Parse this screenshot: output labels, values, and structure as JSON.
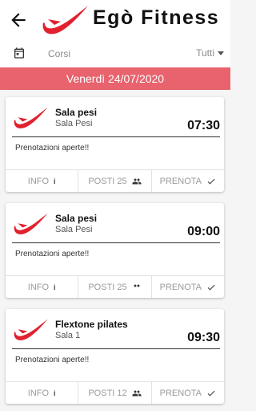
{
  "header": {
    "title": "Egò Fitness",
    "back_icon": "arrow-left-icon",
    "logo_icon": "brand-swoosh-icon"
  },
  "filter": {
    "calendar_icon": "calendar-icon",
    "category_placeholder": "Corsi",
    "selected": "Tutti"
  },
  "date_bar": {
    "label": "Venerdì 24/07/2020"
  },
  "colors": {
    "brand_red": "#e2202e",
    "date_bar": "#e8636e"
  },
  "classes": [
    {
      "title": "Sala pesi",
      "room": "Sala Pesi",
      "time": "07:30",
      "status": "Prenotazioni aperte!!",
      "info_label": "INFO",
      "posti_label": "POSTI 25",
      "prenota_label": "PRENOTA"
    },
    {
      "title": "Sala pesi",
      "room": "Sala Pesi",
      "time": "09:00",
      "status": "Prenotazioni aperte!!",
      "info_label": "INFO",
      "posti_label": "POSTI 25",
      "prenota_label": "PRENOTA"
    },
    {
      "title": "Flextone pilates",
      "room": "Sala 1",
      "time": "09:30",
      "status": "Prenotazioni aperte!!",
      "info_label": "INFO",
      "posti_label": "POSTI 12",
      "prenota_label": "PRENOTA"
    }
  ]
}
